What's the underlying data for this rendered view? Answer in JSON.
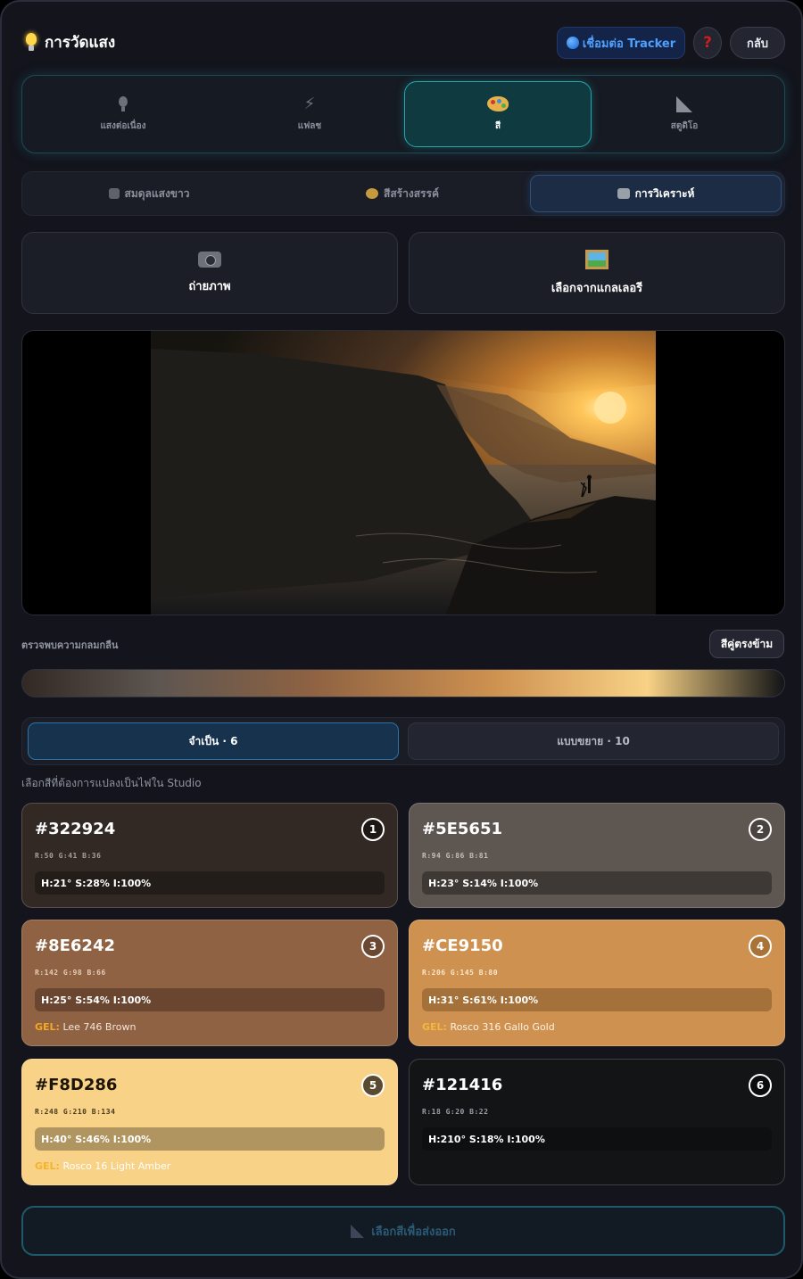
{
  "header": {
    "title": "การวัดแสง",
    "tracker_label": "เชื่อมต่อ Tracker",
    "help_label": "?",
    "back_label": "กลับ"
  },
  "mode_tabs": [
    {
      "label": "แสงต่อเนื่อง",
      "icon": "bulb-icon"
    },
    {
      "label": "แฟลช",
      "icon": "bolt-icon"
    },
    {
      "label": "สี",
      "icon": "palette-icon",
      "active": true
    },
    {
      "label": "สตูดิโอ",
      "icon": "set-square-icon"
    }
  ],
  "sub_tabs": [
    {
      "label": "สมดุลแสงขาว",
      "icon": "balance-icon"
    },
    {
      "label": "สีสร้างสรรค์",
      "icon": "palette-icon"
    },
    {
      "label": "การวิเคราะห์",
      "icon": "camera-flash-icon",
      "active": true
    }
  ],
  "capture": {
    "photo_label": "ถ่ายภาพ",
    "gallery_label": "เลือกจากแกลเลอรี"
  },
  "harmony": {
    "label": "ตรวจพบความกลมกลืน",
    "button": "สีคู่ตรงข้าม"
  },
  "count_tabs": {
    "essential": "จำเป็น · 6",
    "extended": "แบบขยาย · 10"
  },
  "select_hint": "เลือกสีที่ต้องการแปลงเป็นไฟใน Studio",
  "colors": [
    {
      "hex": "#322924",
      "index": "1",
      "rgb": "R:50  G:41  B:36",
      "hsl": "H:21° S:28% I:100%",
      "gel_prefix": "",
      "gel": ""
    },
    {
      "hex": "#5E5651",
      "index": "2",
      "rgb": "R:94  G:86  B:81",
      "hsl": "H:23° S:14% I:100%",
      "gel_prefix": "",
      "gel": ""
    },
    {
      "hex": "#8E6242",
      "index": "3",
      "rgb": "R:142  G:98  B:66",
      "hsl": "H:25° S:54% I:100%",
      "gel_prefix": "GEL:",
      "gel": "Lee 746 Brown"
    },
    {
      "hex": "#CE9150",
      "index": "4",
      "rgb": "R:206  G:145  B:80",
      "hsl": "H:31° S:61% I:100%",
      "gel_prefix": "GEL:",
      "gel": "Rosco 316 Gallo Gold"
    },
    {
      "hex": "#F8D286",
      "index": "5",
      "rgb": "R:248  G:210  B:134",
      "hsl": "H:40° S:46% I:100%",
      "gel_prefix": "GEL:",
      "gel": "Rosco 16 Light Amber"
    },
    {
      "hex": "#121416",
      "index": "6",
      "rgb": "R:18  G:20  B:22",
      "hsl": "H:210° S:18% I:100%",
      "gel_prefix": "",
      "gel": ""
    }
  ],
  "export_label": "เลือกสีเพื่อส่งออก",
  "accent_colors": {
    "teal": "#23a7b0",
    "blue": "#2d73a8",
    "gel_orange": "#f5a623"
  }
}
